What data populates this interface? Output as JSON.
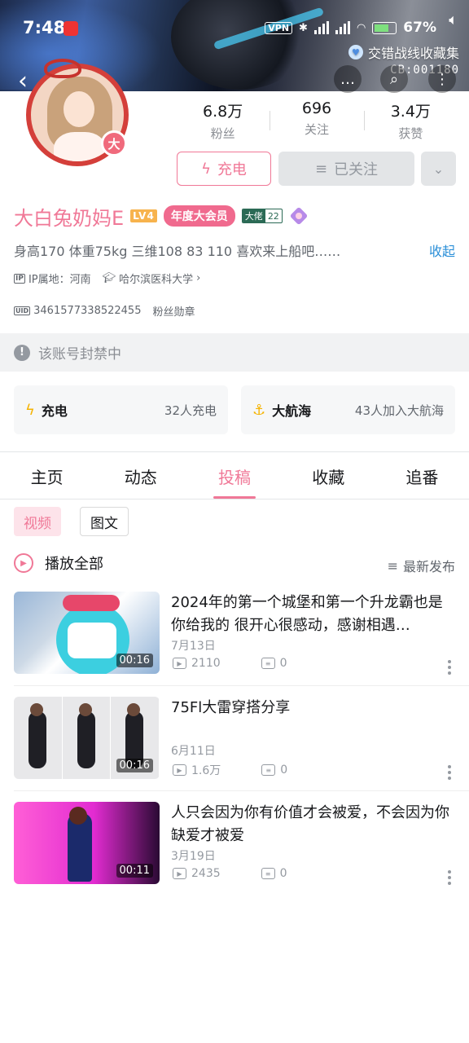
{
  "status_bar": {
    "time": "7:48",
    "vpn": "VPN",
    "battery": "67%"
  },
  "header": {
    "collection_tag": "交错战线收藏集",
    "banner_code": "CB:001180"
  },
  "avatar": {
    "badge": "大"
  },
  "stats": [
    {
      "value": "6.8万",
      "label": "粉丝"
    },
    {
      "value": "696",
      "label": "关注"
    },
    {
      "value": "3.4万",
      "label": "获赞"
    }
  ],
  "actions": {
    "charge": "充电",
    "followed": "已关注"
  },
  "profile": {
    "name": "大白兔奶妈E",
    "level": "LV4",
    "vip": "年度大会员",
    "fans_medal_name": "大佬",
    "fans_medal_level": "22",
    "bio": "身高170 体重75kg 三维108 83 110 喜欢来上船吧……",
    "bio_toggle": "收起",
    "ip_location": "IP属地：河南",
    "school": "哈尔滨医科大学",
    "uid": "3461577338522455",
    "fans_badge": "粉丝勋章"
  },
  "notice": {
    "banned": "该账号封禁中"
  },
  "cards": [
    {
      "title": "充电",
      "info": "32人充电"
    },
    {
      "title": "大航海",
      "info": "43人加入大航海"
    }
  ],
  "tabs": [
    "主页",
    "动态",
    "投稿",
    "收藏",
    "追番"
  ],
  "active_tab": "投稿",
  "sub_tabs": [
    "视频",
    "图文"
  ],
  "list_header": {
    "play_all": "播放全部",
    "sort": "最新发布"
  },
  "videos": [
    {
      "title": "2024年的第一个城堡和第一个升龙霸也是你给我的 很开心很感动，感谢相遇…",
      "duration": "00:16",
      "date": "7月13日",
      "views": "2110",
      "comments": "0"
    },
    {
      "title": "75Fl大雷穿搭分享",
      "duration": "00:16",
      "date": "6月11日",
      "views": "1.6万",
      "comments": "0"
    },
    {
      "title": "人只会因为你有价值才会被爱，不会因为你缺爱才被爱",
      "duration": "00:11",
      "date": "3月19日",
      "views": "2435",
      "comments": "0"
    }
  ],
  "colors": {
    "accent_pink": "#f07897",
    "link_blue": "#2b8fd8",
    "muted_text": "#61666d"
  }
}
